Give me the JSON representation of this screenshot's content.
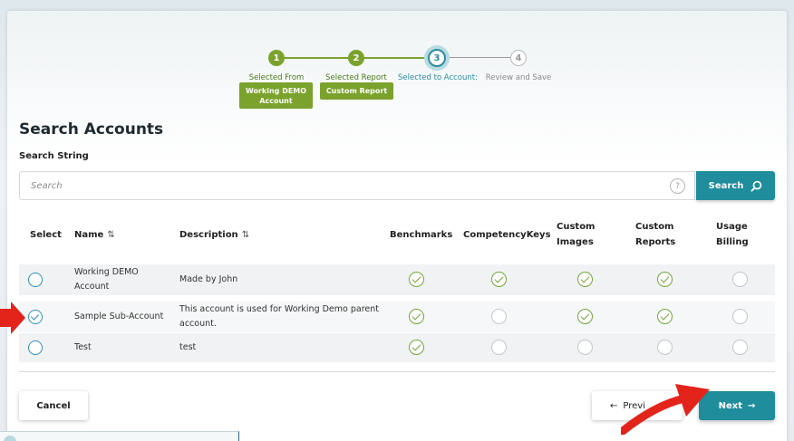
{
  "stepper": {
    "steps": [
      {
        "number": "1",
        "label": "Selected From Account:",
        "status": "done",
        "value": "Working DEMO Account"
      },
      {
        "number": "2",
        "label": "Selected Report Style:",
        "status": "done",
        "value": "Custom Report"
      },
      {
        "number": "3",
        "label": "Selected to Account:",
        "status": "current"
      },
      {
        "number": "4",
        "label": "Review and Save",
        "status": "todo"
      }
    ]
  },
  "page": {
    "title": "Search Accounts",
    "search_label": "Search String",
    "search_placeholder": "Search",
    "search_value": "",
    "help_icon": "?",
    "search_button": "Search"
  },
  "table": {
    "headers": {
      "select": "Select",
      "name": "Name",
      "description": "Description",
      "benchmarks": "Benchmarks",
      "competency_keys": "CompetencyKeys",
      "custom_images_1": "Custom",
      "custom_images_2": "Images",
      "custom_reports_1": "Custom",
      "custom_reports_2": "Reports",
      "usage_billing_1": "Usage",
      "usage_billing_2": "Billing"
    },
    "sort_icon": "⇅",
    "rows": [
      {
        "selected": false,
        "name_1": "Working DEMO",
        "name_2": "Account",
        "desc_1": "Made by John",
        "desc_2": "",
        "benchmarks": true,
        "competency_keys": true,
        "custom_images": true,
        "custom_reports": true,
        "usage_billing": false
      },
      {
        "selected": true,
        "name_1": "Sample Sub-Account",
        "name_2": "",
        "desc_1": "This account is used for Working Demo parent",
        "desc_2": "account.",
        "benchmarks": true,
        "competency_keys": false,
        "custom_images": true,
        "custom_reports": true,
        "usage_billing": false
      },
      {
        "selected": false,
        "name_1": "Test",
        "name_2": "",
        "desc_1": "test",
        "desc_2": "",
        "benchmarks": true,
        "competency_keys": false,
        "custom_images": false,
        "custom_reports": false,
        "usage_billing": false
      }
    ]
  },
  "footer": {
    "cancel": "Cancel",
    "previous": "Previ",
    "previous_arrow": "←",
    "next": "Next",
    "next_arrow": "→"
  },
  "colors": {
    "accent_teal": "#1f8d9c",
    "step_green": "#7aa22c",
    "check_green": "#74a43a",
    "annotation_red": "#e3241b"
  }
}
